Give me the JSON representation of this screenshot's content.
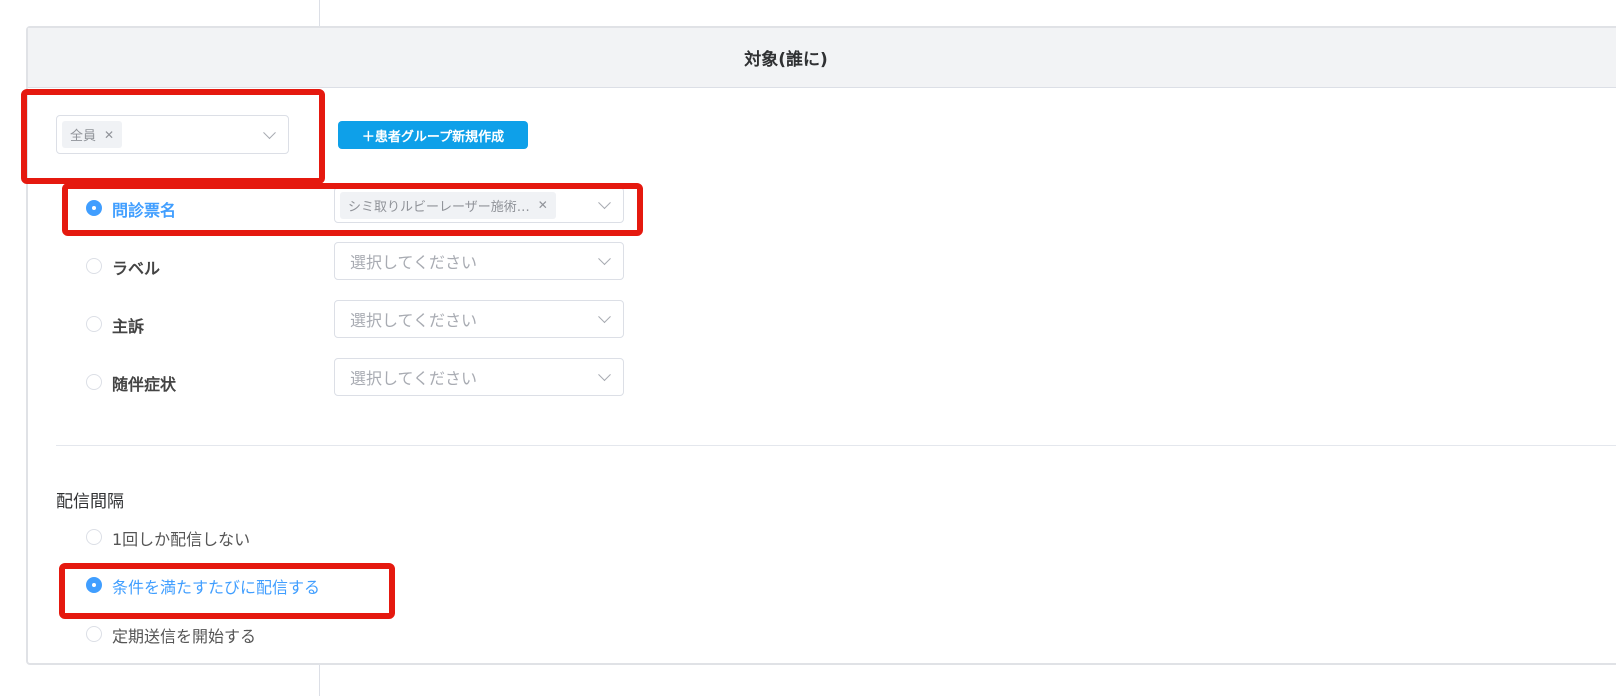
{
  "panel": {
    "title": "対象(誰に)"
  },
  "group_select": {
    "tag": "全員",
    "create_button": "＋患者グループ新規作成"
  },
  "conditions": [
    {
      "label": "問診票名",
      "selected": true,
      "tag": "シミ取りルビーレーザー施術…",
      "placeholder": ""
    },
    {
      "label": "ラベル",
      "selected": false,
      "placeholder": "選択してください"
    },
    {
      "label": "主訴",
      "selected": false,
      "placeholder": "選択してください"
    },
    {
      "label": "随伴症状",
      "selected": false,
      "placeholder": "選択してください"
    }
  ],
  "interval": {
    "title": "配信間隔",
    "options": [
      {
        "label": "1回しか配信しない",
        "selected": false
      },
      {
        "label": "条件を満たすたびに配信する",
        "selected": true
      },
      {
        "label": "定期送信を開始する",
        "selected": false
      }
    ]
  },
  "colors": {
    "accent": "#409eff",
    "button": "#0ea0e9",
    "highlight": "#e5190f"
  }
}
